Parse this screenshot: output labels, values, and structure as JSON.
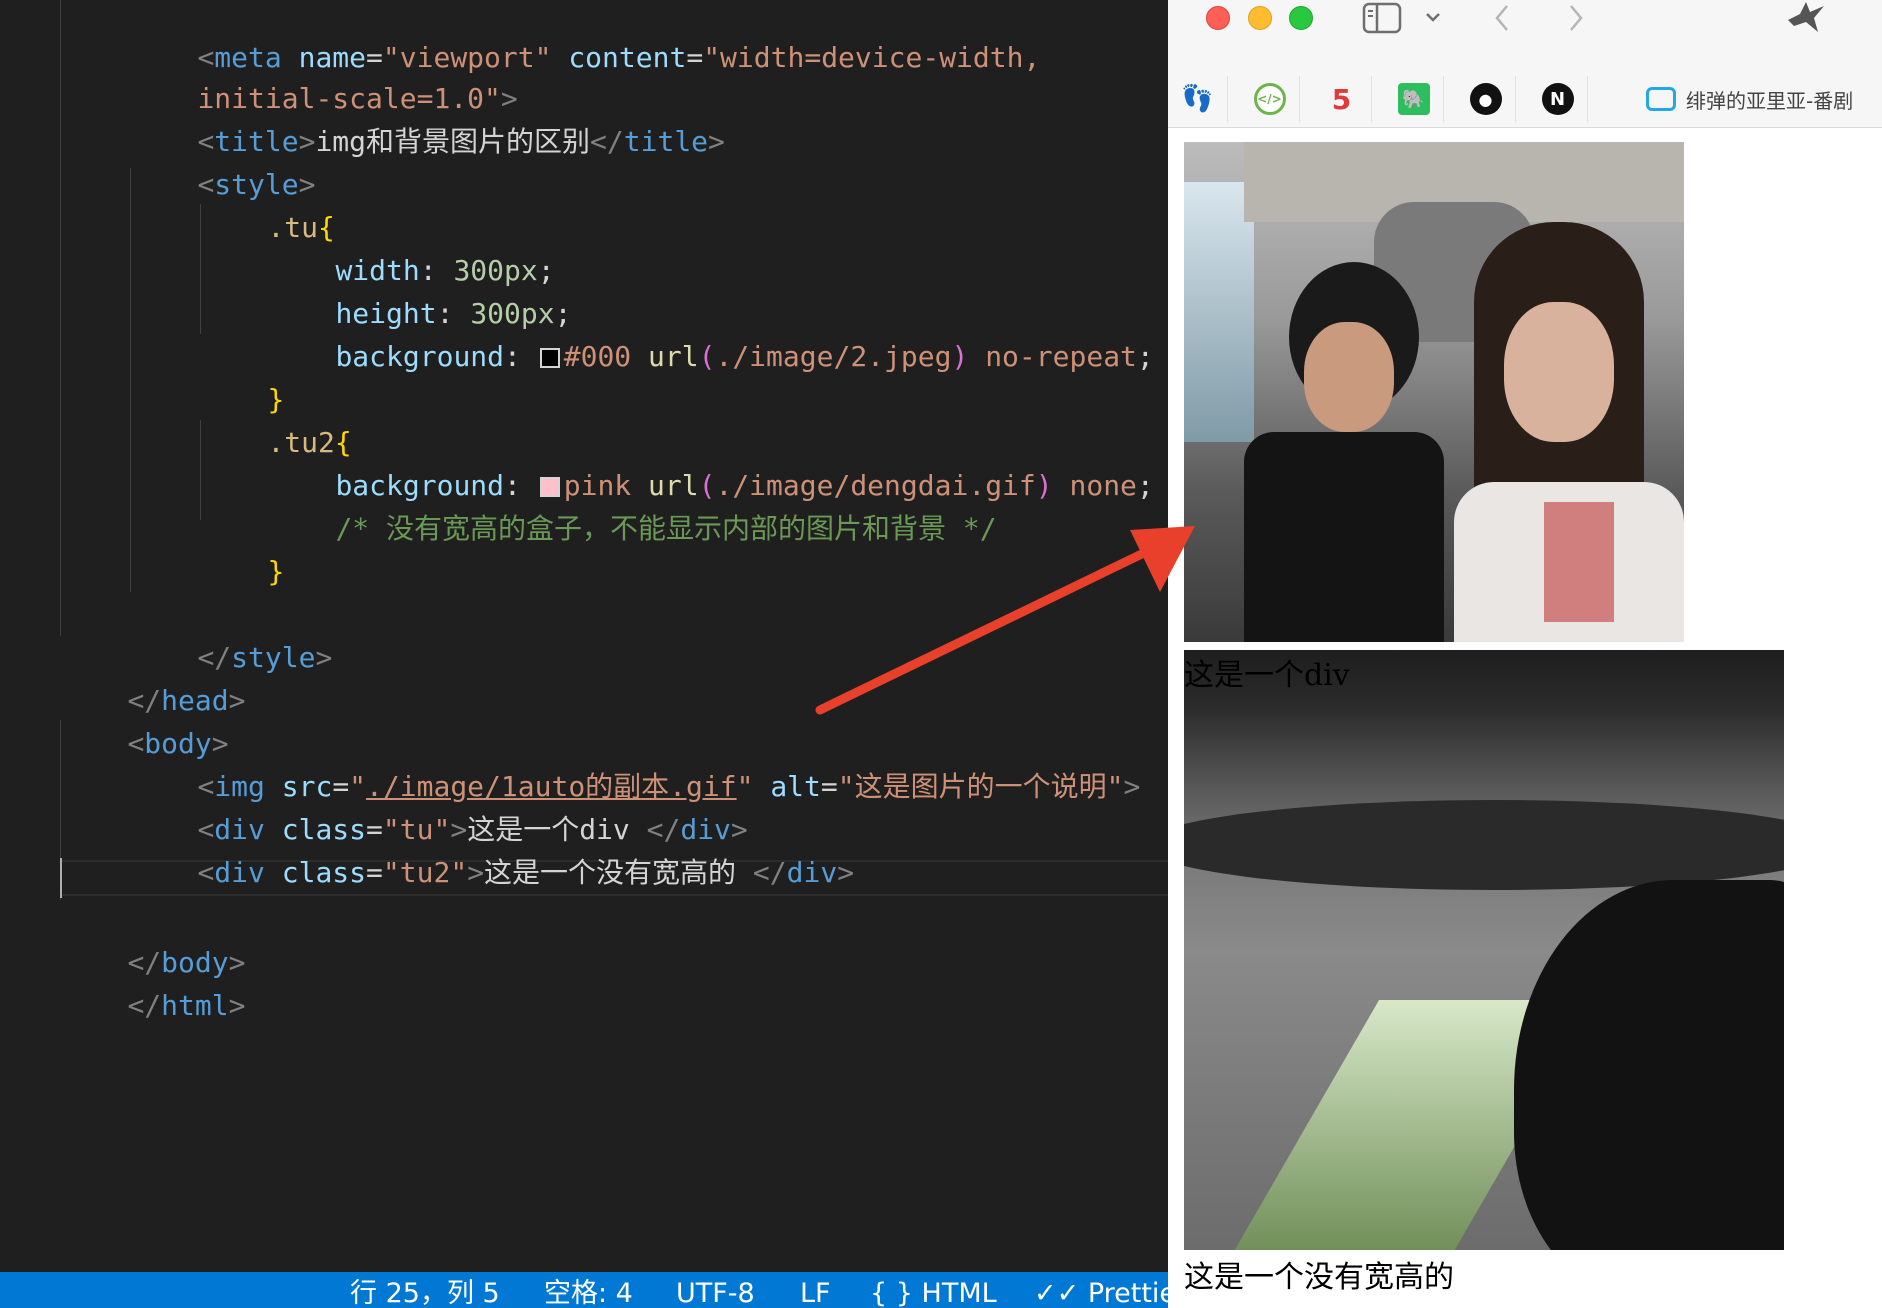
{
  "editor": {
    "lines": {
      "l1": {
        "a": "<",
        "tag": "meta",
        "n1": " name",
        "eq1": "=",
        "v1": "\"viewport\"",
        "n2": " content",
        "eq2": "=",
        "v2": "\"width=device-width,"
      },
      "l2": {
        "v": "initial-scale=1.0\"",
        "b": ">"
      },
      "l3": {
        "a": "<",
        "tag": "title",
        "b": ">",
        "text": "img和背景图片的区别",
        "c": "</",
        "tag2": "title",
        "d": ">"
      },
      "l4": {
        "a": "<",
        "tag": "style",
        "b": ">"
      },
      "l5": {
        "sel": ".tu",
        "brace": "{"
      },
      "l6": {
        "prop": "width",
        "colon": ": ",
        "num": "300px",
        "semi": ";"
      },
      "l7": {
        "prop": "height",
        "colon": ": ",
        "num": "300px",
        "semi": ";"
      },
      "l8": {
        "prop": "background",
        "colon": ": ",
        "color": "#000",
        "fn": " url",
        "p1": "(",
        "arg": "./image/2.jpeg",
        "p2": ")",
        "kw": " no-repeat",
        "semi": ";"
      },
      "l9": {
        "brace": "}"
      },
      "l10": {
        "sel": ".tu2",
        "brace": "{"
      },
      "l11": {
        "prop": "background",
        "colon": ": ",
        "color": "pink",
        "fn": " url",
        "p1": "(",
        "arg": "./image/dengdai.gif",
        "p2": ")",
        "kw": " none",
        "semi": ";"
      },
      "l12": {
        "comment": "/* 没有宽高的盒子，不能显示内部的图片和背景 */"
      },
      "l13": {
        "brace": "}"
      },
      "l14": {
        "a": "</",
        "tag": "style",
        "b": ">"
      },
      "l15": {
        "a": "</",
        "tag": "head",
        "b": ">"
      },
      "l16": {
        "a": "<",
        "tag": "body",
        "b": ">"
      },
      "l17": {
        "a": "<",
        "tag": "img",
        "n1": " src",
        "eq1": "=",
        "q1": "\"",
        "src": "./image/1auto的副本.gif",
        "q2": "\"",
        "n2": " alt",
        "eq2": "=",
        "v2": "\"这是图片的一个说明\"",
        "b": ">"
      },
      "l18": {
        "a": "<",
        "tag": "div",
        "n1": " class",
        "eq1": "=",
        "v1": "\"tu\"",
        "b": ">",
        "text": "这是一个div ",
        "c": "</",
        "tag2": "div",
        "d": ">"
      },
      "l19": {
        "a": "<",
        "tag": "div",
        "n1": " class",
        "eq1": "=",
        "v1": "\"tu2\"",
        "b": ">",
        "text": "这是一个没有宽高的 ",
        "c": "</",
        "tag2": "div",
        "d": ">"
      },
      "l20": {
        "a": "</",
        "tag": "body",
        "b": ">"
      },
      "l21": {
        "a": "</",
        "tag": "html",
        "b": ">"
      }
    },
    "swatch_colors": {
      "black": "#000000",
      "pink": "#ffc0cb"
    }
  },
  "statusbar": {
    "position": "行 25，列 5",
    "spaces": "空格: 4",
    "encoding": "UTF-8",
    "eol": "LF",
    "language": "{ } HTML",
    "prettier": "✓✓ Prettie"
  },
  "browser": {
    "toolbar_icons": [
      "sidebar-toggle-icon",
      "chevron-down-icon",
      "back-arrow-icon",
      "forward-arrow-icon",
      "bird-extension-icon"
    ],
    "favorites": [
      "footprint-icon",
      "code-icon",
      "five-icon",
      "evernote-icon",
      "github-icon",
      "notion-icon",
      "bilibili-icon"
    ],
    "bilibili_label": "绯弹的亚里亚-番剧",
    "page": {
      "div_text": "这是一个div",
      "div2_text": "这是一个没有宽高的"
    }
  },
  "colors": {
    "arrow": "#e8402b",
    "statusbar": "#0078d4"
  }
}
